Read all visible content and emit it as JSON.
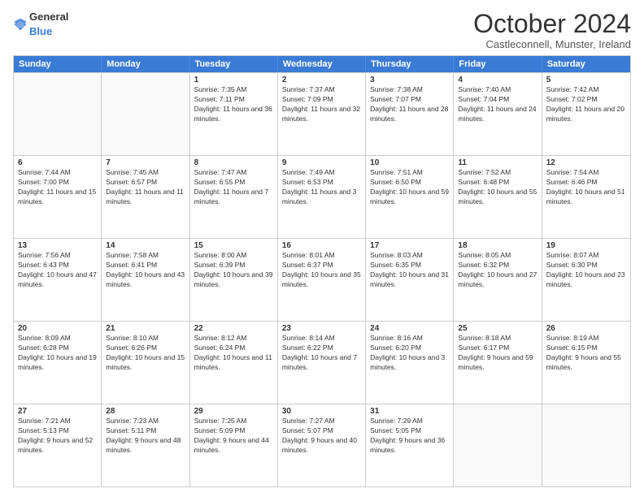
{
  "logo": {
    "general": "General",
    "blue": "Blue"
  },
  "title": "October 2024",
  "location": "Castleconnell, Munster, Ireland",
  "header_days": [
    "Sunday",
    "Monday",
    "Tuesday",
    "Wednesday",
    "Thursday",
    "Friday",
    "Saturday"
  ],
  "weeks": [
    [
      {
        "day": "",
        "sunrise": "",
        "sunset": "",
        "daylight": ""
      },
      {
        "day": "",
        "sunrise": "",
        "sunset": "",
        "daylight": ""
      },
      {
        "day": "1",
        "sunrise": "Sunrise: 7:35 AM",
        "sunset": "Sunset: 7:11 PM",
        "daylight": "Daylight: 11 hours and 36 minutes."
      },
      {
        "day": "2",
        "sunrise": "Sunrise: 7:37 AM",
        "sunset": "Sunset: 7:09 PM",
        "daylight": "Daylight: 11 hours and 32 minutes."
      },
      {
        "day": "3",
        "sunrise": "Sunrise: 7:38 AM",
        "sunset": "Sunset: 7:07 PM",
        "daylight": "Daylight: 11 hours and 28 minutes."
      },
      {
        "day": "4",
        "sunrise": "Sunrise: 7:40 AM",
        "sunset": "Sunset: 7:04 PM",
        "daylight": "Daylight: 11 hours and 24 minutes."
      },
      {
        "day": "5",
        "sunrise": "Sunrise: 7:42 AM",
        "sunset": "Sunset: 7:02 PM",
        "daylight": "Daylight: 11 hours and 20 minutes."
      }
    ],
    [
      {
        "day": "6",
        "sunrise": "Sunrise: 7:44 AM",
        "sunset": "Sunset: 7:00 PM",
        "daylight": "Daylight: 11 hours and 15 minutes."
      },
      {
        "day": "7",
        "sunrise": "Sunrise: 7:45 AM",
        "sunset": "Sunset: 6:57 PM",
        "daylight": "Daylight: 11 hours and 11 minutes."
      },
      {
        "day": "8",
        "sunrise": "Sunrise: 7:47 AM",
        "sunset": "Sunset: 6:55 PM",
        "daylight": "Daylight: 11 hours and 7 minutes."
      },
      {
        "day": "9",
        "sunrise": "Sunrise: 7:49 AM",
        "sunset": "Sunset: 6:53 PM",
        "daylight": "Daylight: 11 hours and 3 minutes."
      },
      {
        "day": "10",
        "sunrise": "Sunrise: 7:51 AM",
        "sunset": "Sunset: 6:50 PM",
        "daylight": "Daylight: 10 hours and 59 minutes."
      },
      {
        "day": "11",
        "sunrise": "Sunrise: 7:52 AM",
        "sunset": "Sunset: 6:48 PM",
        "daylight": "Daylight: 10 hours and 55 minutes."
      },
      {
        "day": "12",
        "sunrise": "Sunrise: 7:54 AM",
        "sunset": "Sunset: 6:46 PM",
        "daylight": "Daylight: 10 hours and 51 minutes."
      }
    ],
    [
      {
        "day": "13",
        "sunrise": "Sunrise: 7:56 AM",
        "sunset": "Sunset: 6:43 PM",
        "daylight": "Daylight: 10 hours and 47 minutes."
      },
      {
        "day": "14",
        "sunrise": "Sunrise: 7:58 AM",
        "sunset": "Sunset: 6:41 PM",
        "daylight": "Daylight: 10 hours and 43 minutes."
      },
      {
        "day": "15",
        "sunrise": "Sunrise: 8:00 AM",
        "sunset": "Sunset: 6:39 PM",
        "daylight": "Daylight: 10 hours and 39 minutes."
      },
      {
        "day": "16",
        "sunrise": "Sunrise: 8:01 AM",
        "sunset": "Sunset: 6:37 PM",
        "daylight": "Daylight: 10 hours and 35 minutes."
      },
      {
        "day": "17",
        "sunrise": "Sunrise: 8:03 AM",
        "sunset": "Sunset: 6:35 PM",
        "daylight": "Daylight: 10 hours and 31 minutes."
      },
      {
        "day": "18",
        "sunrise": "Sunrise: 8:05 AM",
        "sunset": "Sunset: 6:32 PM",
        "daylight": "Daylight: 10 hours and 27 minutes."
      },
      {
        "day": "19",
        "sunrise": "Sunrise: 8:07 AM",
        "sunset": "Sunset: 6:30 PM",
        "daylight": "Daylight: 10 hours and 23 minutes."
      }
    ],
    [
      {
        "day": "20",
        "sunrise": "Sunrise: 8:09 AM",
        "sunset": "Sunset: 6:28 PM",
        "daylight": "Daylight: 10 hours and 19 minutes."
      },
      {
        "day": "21",
        "sunrise": "Sunrise: 8:10 AM",
        "sunset": "Sunset: 6:26 PM",
        "daylight": "Daylight: 10 hours and 15 minutes."
      },
      {
        "day": "22",
        "sunrise": "Sunrise: 8:12 AM",
        "sunset": "Sunset: 6:24 PM",
        "daylight": "Daylight: 10 hours and 11 minutes."
      },
      {
        "day": "23",
        "sunrise": "Sunrise: 8:14 AM",
        "sunset": "Sunset: 6:22 PM",
        "daylight": "Daylight: 10 hours and 7 minutes."
      },
      {
        "day": "24",
        "sunrise": "Sunrise: 8:16 AM",
        "sunset": "Sunset: 6:20 PM",
        "daylight": "Daylight: 10 hours and 3 minutes."
      },
      {
        "day": "25",
        "sunrise": "Sunrise: 8:18 AM",
        "sunset": "Sunset: 6:17 PM",
        "daylight": "Daylight: 9 hours and 59 minutes."
      },
      {
        "day": "26",
        "sunrise": "Sunrise: 8:19 AM",
        "sunset": "Sunset: 6:15 PM",
        "daylight": "Daylight: 9 hours and 55 minutes."
      }
    ],
    [
      {
        "day": "27",
        "sunrise": "Sunrise: 7:21 AM",
        "sunset": "Sunset: 5:13 PM",
        "daylight": "Daylight: 9 hours and 52 minutes."
      },
      {
        "day": "28",
        "sunrise": "Sunrise: 7:23 AM",
        "sunset": "Sunset: 5:11 PM",
        "daylight": "Daylight: 9 hours and 48 minutes."
      },
      {
        "day": "29",
        "sunrise": "Sunrise: 7:25 AM",
        "sunset": "Sunset: 5:09 PM",
        "daylight": "Daylight: 9 hours and 44 minutes."
      },
      {
        "day": "30",
        "sunrise": "Sunrise: 7:27 AM",
        "sunset": "Sunset: 5:07 PM",
        "daylight": "Daylight: 9 hours and 40 minutes."
      },
      {
        "day": "31",
        "sunrise": "Sunrise: 7:29 AM",
        "sunset": "Sunset: 5:05 PM",
        "daylight": "Daylight: 9 hours and 36 minutes."
      },
      {
        "day": "",
        "sunrise": "",
        "sunset": "",
        "daylight": ""
      },
      {
        "day": "",
        "sunrise": "",
        "sunset": "",
        "daylight": ""
      }
    ]
  ]
}
